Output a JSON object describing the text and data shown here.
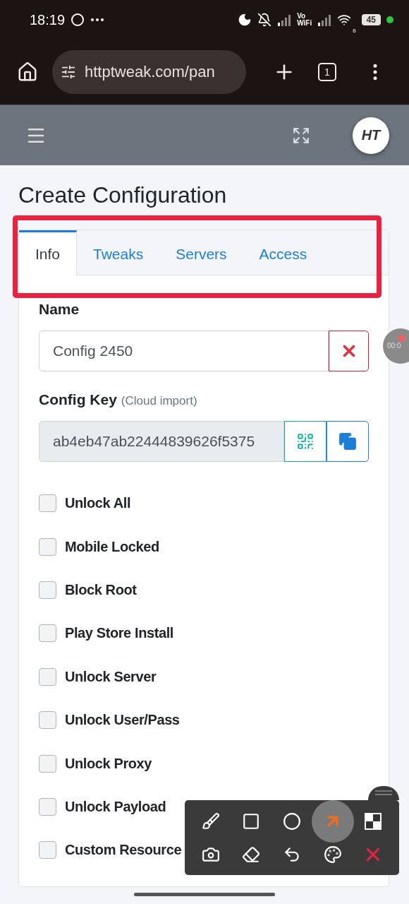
{
  "status_bar": {
    "time": "18:19",
    "vowifi": [
      "Vo",
      "WiFi"
    ],
    "wifi_badge": "6",
    "battery": "45"
  },
  "browser": {
    "url": "httptweak.com/pan",
    "tab_count": "1"
  },
  "header": {
    "logo": "HT"
  },
  "recorder": {
    "time": "00:0"
  },
  "page": {
    "title": "Create Configuration"
  },
  "tabs": [
    {
      "label": "Info",
      "selected": true
    },
    {
      "label": "Tweaks",
      "selected": false
    },
    {
      "label": "Servers",
      "selected": false
    },
    {
      "label": "Access",
      "selected": false
    }
  ],
  "form": {
    "name": {
      "label": "Name",
      "value": "Config 2450"
    },
    "config_key": {
      "label": "Config Key",
      "hint": "(Cloud import)",
      "value": "ab4eb47ab22444839626f5375"
    }
  },
  "options": [
    {
      "label": "Unlock All",
      "checked": false
    },
    {
      "label": "Mobile Locked",
      "checked": false
    },
    {
      "label": "Block Root",
      "checked": false
    },
    {
      "label": "Play Store Install",
      "checked": false
    },
    {
      "label": "Unlock Server",
      "checked": false
    },
    {
      "label": "Unlock User/Pass",
      "checked": false
    },
    {
      "label": "Unlock Proxy",
      "checked": false
    },
    {
      "label": "Unlock Payload",
      "checked": false
    },
    {
      "label": "Custom Resource",
      "checked": false
    }
  ],
  "draw_toolbar": {
    "tools": [
      {
        "kind": "brush",
        "selected": false
      },
      {
        "kind": "rectangle",
        "selected": false
      },
      {
        "kind": "circle",
        "selected": false
      },
      {
        "kind": "arrow",
        "selected": true
      },
      {
        "kind": "mosaic",
        "selected": false
      },
      {
        "kind": "camera",
        "selected": false
      },
      {
        "kind": "eraser",
        "selected": false
      },
      {
        "kind": "undo",
        "selected": false
      },
      {
        "kind": "palette",
        "selected": false
      },
      {
        "kind": "close",
        "selected": false
      }
    ]
  }
}
